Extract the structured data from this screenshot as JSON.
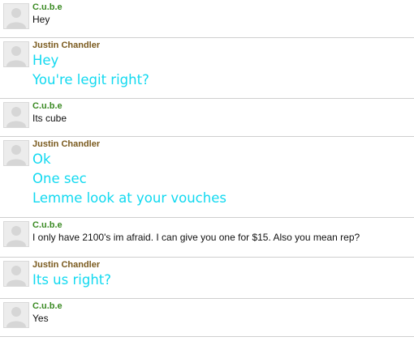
{
  "colors": {
    "cube_name": "#3a8a23",
    "justin_name": "#7a5a1e",
    "big_text": "#11d9f0",
    "small_text": "#111111",
    "divider": "#cfcfcf"
  },
  "messages": [
    {
      "sender": "C.u.b.e",
      "lines": [
        "Hey"
      ]
    },
    {
      "sender": "Justin Chandler",
      "lines": [
        "Hey",
        "You're legit right?"
      ]
    },
    {
      "sender": "C.u.b.e",
      "lines": [
        "Its cube"
      ]
    },
    {
      "sender": "Justin Chandler",
      "lines": [
        "Ok",
        "One sec",
        "Lemme look at your vouches"
      ]
    },
    {
      "sender": "C.u.b.e",
      "lines": [
        "I only have 2100's im afraid. I can give you one for $15. Also you mean rep?"
      ]
    },
    {
      "sender": "Justin Chandler",
      "lines": [
        "Its us right?"
      ]
    },
    {
      "sender": "C.u.b.e",
      "lines": [
        "Yes"
      ]
    }
  ]
}
